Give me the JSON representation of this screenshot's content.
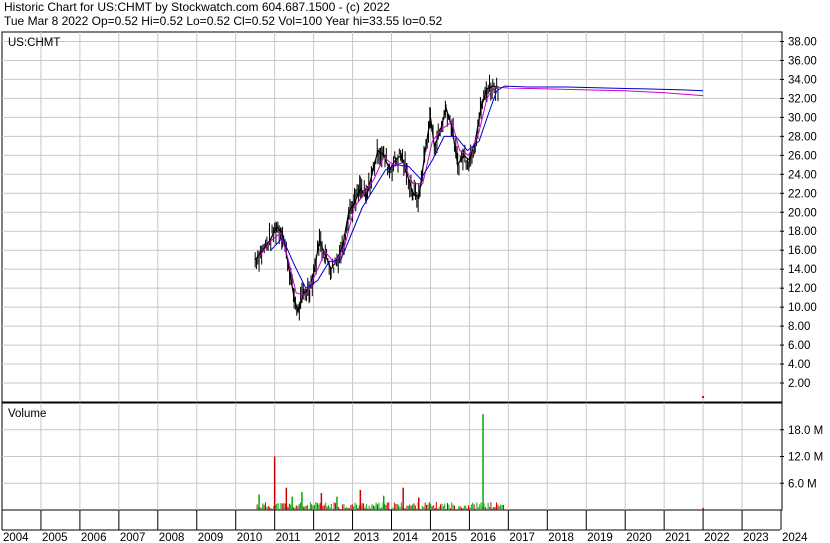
{
  "header": {
    "line1": "Historic Chart for US:CHMT by Stockwatch.com 604.687.1500 - (c) 2022",
    "line2": "Tue Mar  8 2022  Op=0.52  Hi=0.52  Lo=0.52  Cl=0.52  Vol=100  Year hi=33.55  lo=0.52"
  },
  "chart_data": [
    {
      "type": "line",
      "title": "US:CHMT",
      "ylim": [
        0,
        39
      ],
      "y_ticks": [
        "2.00",
        "4.00",
        "6.00",
        "8.00",
        "10.00",
        "12.00",
        "14.00",
        "16.00",
        "18.00",
        "20.00",
        "22.00",
        "24.00",
        "26.00",
        "28.00",
        "30.00",
        "32.00",
        "34.00",
        "36.00",
        "38.00"
      ],
      "x_ticks": [
        "2004",
        "2005",
        "2006",
        "2007",
        "2008",
        "2009",
        "2010",
        "2011",
        "2012",
        "2013",
        "2014",
        "2015",
        "2016",
        "2017",
        "2018",
        "2019",
        "2020",
        "2021",
        "2022",
        "2023",
        "2024"
      ],
      "grid": true,
      "series": [
        {
          "color": "#000000",
          "points": [
            [
              2010.5,
              15.0
            ],
            [
              2010.7,
              16.0
            ],
            [
              2010.9,
              17.2
            ],
            [
              2011.05,
              18.5
            ],
            [
              2011.2,
              17.8
            ],
            [
              2011.35,
              14.5
            ],
            [
              2011.5,
              11.0
            ],
            [
              2011.6,
              9.5
            ],
            [
              2011.75,
              11.5
            ],
            [
              2011.9,
              12.0
            ],
            [
              2012.0,
              13.5
            ],
            [
              2012.15,
              17.0
            ],
            [
              2012.3,
              15.5
            ],
            [
              2012.45,
              14.0
            ],
            [
              2012.6,
              15.0
            ],
            [
              2012.75,
              16.5
            ],
            [
              2012.9,
              20.0
            ],
            [
              2013.05,
              21.0
            ],
            [
              2013.2,
              22.5
            ],
            [
              2013.35,
              21.5
            ],
            [
              2013.5,
              24.0
            ],
            [
              2013.65,
              26.5
            ],
            [
              2013.8,
              26.0
            ],
            [
              2013.95,
              24.5
            ],
            [
              2014.1,
              25.5
            ],
            [
              2014.25,
              26.0
            ],
            [
              2014.4,
              24.0
            ],
            [
              2014.55,
              22.0
            ],
            [
              2014.7,
              21.5
            ],
            [
              2014.85,
              26.0
            ],
            [
              2015.0,
              30.0
            ],
            [
              2015.1,
              27.0
            ],
            [
              2015.25,
              28.5
            ],
            [
              2015.4,
              31.0
            ],
            [
              2015.55,
              29.0
            ],
            [
              2015.7,
              25.0
            ],
            [
              2015.85,
              26.0
            ],
            [
              2016.0,
              25.5
            ],
            [
              2016.15,
              27.5
            ],
            [
              2016.3,
              31.0
            ],
            [
              2016.45,
              33.0
            ],
            [
              2016.6,
              33.3
            ],
            [
              2016.75,
              33.2
            ]
          ]
        },
        {
          "color": "#cc00cc",
          "points": [
            [
              2010.6,
              15.3
            ],
            [
              2010.9,
              17.0
            ],
            [
              2011.15,
              17.8
            ],
            [
              2011.35,
              15.0
            ],
            [
              2011.55,
              11.5
            ],
            [
              2011.8,
              11.2
            ],
            [
              2012.05,
              13.5
            ],
            [
              2012.3,
              15.8
            ],
            [
              2012.55,
              14.6
            ],
            [
              2012.8,
              16.5
            ],
            [
              2013.05,
              20.5
            ],
            [
              2013.3,
              22.0
            ],
            [
              2013.55,
              23.5
            ],
            [
              2013.8,
              25.8
            ],
            [
              2014.05,
              25.0
            ],
            [
              2014.3,
              25.2
            ],
            [
              2014.55,
              23.0
            ],
            [
              2014.8,
              23.0
            ],
            [
              2015.05,
              27.5
            ],
            [
              2015.3,
              28.8
            ],
            [
              2015.55,
              29.5
            ],
            [
              2015.75,
              26.5
            ],
            [
              2016.0,
              26.0
            ],
            [
              2016.25,
              28.5
            ],
            [
              2016.45,
              32.0
            ],
            [
              2016.65,
              33.2
            ],
            [
              2017.0,
              33.1
            ],
            [
              2018.0,
              33.0
            ],
            [
              2019.0,
              32.9
            ],
            [
              2020.0,
              32.8
            ],
            [
              2021.0,
              32.6
            ],
            [
              2022.0,
              32.3
            ]
          ]
        },
        {
          "color": "#0000cc",
          "points": [
            [
              2010.9,
              16.0
            ],
            [
              2011.2,
              17.3
            ],
            [
              2011.5,
              14.5
            ],
            [
              2011.8,
              12.0
            ],
            [
              2012.1,
              12.8
            ],
            [
              2012.4,
              14.8
            ],
            [
              2012.7,
              15.0
            ],
            [
              2012.95,
              17.5
            ],
            [
              2013.25,
              20.5
            ],
            [
              2013.55,
              22.5
            ],
            [
              2013.85,
              24.5
            ],
            [
              2014.15,
              25.0
            ],
            [
              2014.45,
              24.8
            ],
            [
              2014.75,
              23.5
            ],
            [
              2015.05,
              25.5
            ],
            [
              2015.35,
              28.0
            ],
            [
              2015.65,
              28.0
            ],
            [
              2015.95,
              26.5
            ],
            [
              2016.25,
              27.5
            ],
            [
              2016.5,
              30.5
            ],
            [
              2016.7,
              32.8
            ],
            [
              2016.9,
              33.3
            ],
            [
              2017.5,
              33.2
            ],
            [
              2018.5,
              33.2
            ],
            [
              2019.5,
              33.1
            ],
            [
              2020.5,
              33.0
            ],
            [
              2021.5,
              32.9
            ],
            [
              2022.0,
              32.8
            ]
          ]
        }
      ],
      "markers": [
        {
          "x": 2022.0,
          "y": 0.52,
          "color": "#cc0000"
        }
      ]
    },
    {
      "type": "bar",
      "title": "Volume",
      "ylim": [
        0,
        24
      ],
      "y_ticks": [
        "6.0 M",
        "12.0 M",
        "18.0 M"
      ],
      "spikes": [
        {
          "x": 2010.6,
          "value": 3.5,
          "color": "#00aa00"
        },
        {
          "x": 2011.0,
          "value": 12.0,
          "color": "#cc0000"
        },
        {
          "x": 2011.3,
          "value": 5.0,
          "color": "#cc0000"
        },
        {
          "x": 2011.45,
          "value": 3.0,
          "color": "#00aa00"
        },
        {
          "x": 2011.7,
          "value": 4.0,
          "color": "#00aa00"
        },
        {
          "x": 2012.2,
          "value": 3.8,
          "color": "#cc0000"
        },
        {
          "x": 2012.6,
          "value": 3.0,
          "color": "#00aa00"
        },
        {
          "x": 2013.2,
          "value": 4.5,
          "color": "#cc0000"
        },
        {
          "x": 2013.8,
          "value": 3.2,
          "color": "#00aa00"
        },
        {
          "x": 2014.3,
          "value": 5.0,
          "color": "#cc0000"
        },
        {
          "x": 2014.7,
          "value": 2.8,
          "color": "#cc0000"
        },
        {
          "x": 2016.35,
          "value": 21.5,
          "color": "#00aa00"
        },
        {
          "x": 2022.0,
          "value": 0.5,
          "color": "#cc0000"
        }
      ]
    }
  ]
}
